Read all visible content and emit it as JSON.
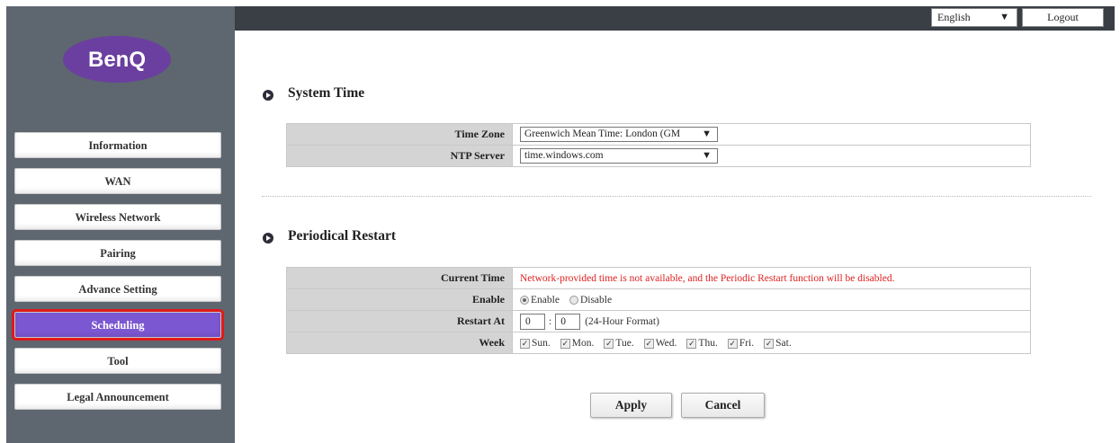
{
  "header": {
    "language": "English",
    "logout_label": "Logout"
  },
  "brand": {
    "logo_text": "BenQ"
  },
  "sidebar": {
    "items": [
      {
        "label": "Information"
      },
      {
        "label": "WAN"
      },
      {
        "label": "Wireless Network"
      },
      {
        "label": "Pairing"
      },
      {
        "label": "Advance Setting"
      },
      {
        "label": "Scheduling",
        "active": true
      },
      {
        "label": "Tool"
      },
      {
        "label": "Legal Announcement"
      }
    ]
  },
  "system_time": {
    "title": "System Time",
    "time_zone_label": "Time Zone",
    "time_zone_value": "Greenwich Mean Time: London (GM",
    "ntp_label": "NTP Server",
    "ntp_value": "time.windows.com"
  },
  "periodical_restart": {
    "title": "Periodical Restart",
    "current_time_label": "Current Time",
    "current_time_warning": "Network-provided time is not available, and the Periodic Restart function will be disabled.",
    "enable_label": "Enable",
    "enable_option": "Enable",
    "disable_option": "Disable",
    "enable_selected": "Enable",
    "restart_at_label": "Restart At",
    "hour": "0",
    "separator": ":",
    "minute": "0",
    "format_note": "(24-Hour Format)",
    "week_label": "Week",
    "days": [
      "Sun.",
      "Mon.",
      "Tue.",
      "Wed.",
      "Thu.",
      "Fri.",
      "Sat."
    ]
  },
  "actions": {
    "apply_label": "Apply",
    "cancel_label": "Cancel"
  },
  "colors": {
    "sidebar_bg": "#5e6670",
    "topbar_bg": "#3a3e45",
    "active_item": "#7b57d1",
    "highlight_border": "#e01919",
    "warning_text": "#e02020",
    "logo_bg": "#6b3fa0"
  }
}
